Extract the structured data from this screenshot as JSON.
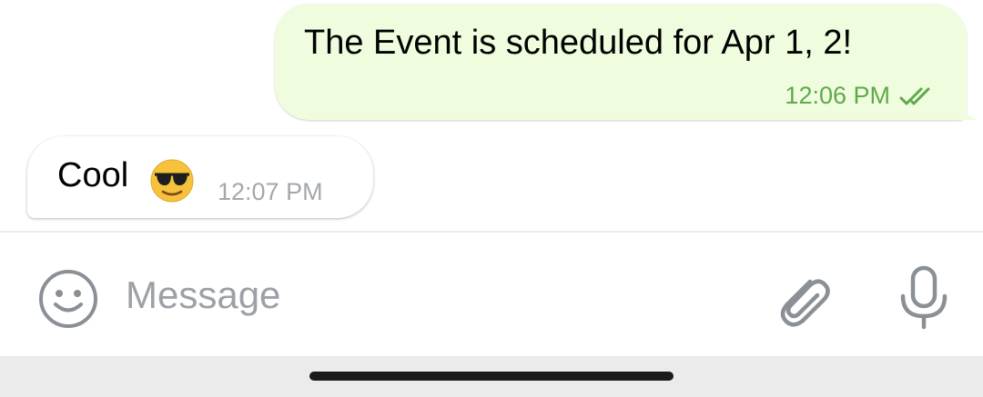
{
  "messages": [
    {
      "direction": "outgoing",
      "text": "The Event is scheduled for Apr 1, 2!",
      "time": "12:06 PM",
      "status_icon": "double-check-icon"
    },
    {
      "direction": "incoming",
      "text": "Cool",
      "emoji": "smiling-face-with-sunglasses",
      "time": "12:07 PM"
    }
  ],
  "composer": {
    "placeholder": "Message",
    "value": "",
    "emoji_icon": "smiley-face-icon",
    "attach_icon": "paperclip-icon",
    "mic_icon": "microphone-icon"
  },
  "colors": {
    "outgoing_bubble": "#effdde",
    "outgoing_meta": "#5fa94a",
    "incoming_meta": "#a3a8ad",
    "placeholder": "#9ba1a7",
    "icon_gray": "#8a9096"
  }
}
